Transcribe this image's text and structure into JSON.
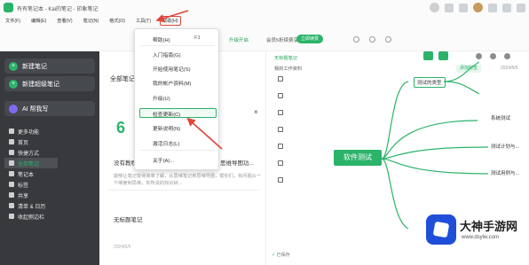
{
  "app": {
    "title": "有有笔记本 - Kai的笔记 - 印象笔记"
  },
  "menubar": {
    "items": [
      "文件(F)",
      "编辑(E)",
      "查看(V)",
      "笔记(N)",
      "格式(O)",
      "工具(T)",
      "帮助(H)"
    ],
    "active_index": 6
  },
  "toolbar": {
    "link_text": "升级开启",
    "promo_text": "会员5折续费享",
    "vip_button": "立即续费"
  },
  "sidebar": {
    "new_note": "新建笔记",
    "new_super_note": "新建超级笔记",
    "ai": "AI 帮我写",
    "items": [
      {
        "label": "更多功能",
        "icon": "grid-icon"
      },
      {
        "label": "首页",
        "icon": "home-icon"
      },
      {
        "label": "快捷方式",
        "icon": "star-icon"
      },
      {
        "label": "全部笔记",
        "icon": "notes-icon"
      },
      {
        "label": "笔记本",
        "icon": "notebook-icon"
      },
      {
        "label": "标签",
        "icon": "tag-icon"
      },
      {
        "label": "共享",
        "icon": "share-icon"
      },
      {
        "label": "清单 & 日历",
        "icon": "calendar-icon"
      },
      {
        "label": "收起侧边栏",
        "icon": "collapse-icon"
      }
    ],
    "selected_index": 3
  },
  "notelist": {
    "title": "全部笔记",
    "close": "×",
    "big_number": "6",
    "card1": {
      "title": "没有教程",
      "title_right": "思维导图功...",
      "body": "能够让笔记变得简单了解，从思维笔记到思维导图，帮你们，有问题从一个维度到思维，你所说的知识树..."
    },
    "card2": {
      "title": "无标题笔记",
      "date": "2024/5/5"
    }
  },
  "editor": {
    "crumb": "无标题笔记",
    "notebook": "我的工作资料",
    "tag": "添加标签",
    "date": "2024/5/5",
    "status_prefix": "✓",
    "status": "已保存"
  },
  "mindmap": {
    "root": "软件测试",
    "nodes": [
      "测试的类型",
      "系统测试",
      "测试计划与...",
      "测试用例与..."
    ]
  },
  "help_menu": {
    "items": [
      {
        "label": "帮助(H)",
        "shortcut": "F1"
      },
      {
        "label": "入门指南(G)"
      },
      {
        "label": "开始使用笔记(S)"
      },
      {
        "label": "我的帐户资料(M)"
      },
      {
        "label": "升级(U)"
      },
      {
        "label": "检查更新(C)"
      },
      {
        "label": "更新说明(N)"
      },
      {
        "label": "激活日志(L)"
      },
      {
        "label": "关于(A)..."
      }
    ],
    "highlight_index": 5
  },
  "watermark": {
    "title": "大神手游网",
    "url": "www.dsylw.com"
  },
  "colors": {
    "accent": "#2bb36a",
    "annotation_red": "#e0463a",
    "sidebar_bg": "#37393d"
  }
}
